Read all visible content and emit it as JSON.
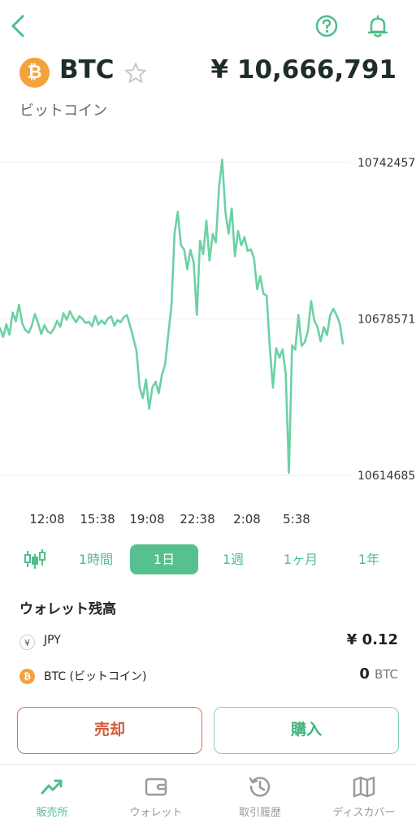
{
  "header": {
    "coin_symbol": "BTC",
    "coin_logo_glyph": "₿",
    "price": "¥ 10,666,791",
    "coin_name": "ビットコイン",
    "icons": [
      "back-chevron-icon",
      "help-icon",
      "bell-icon",
      "star-icon"
    ]
  },
  "chart_data": {
    "type": "line",
    "y_ticks": [
      "10742457",
      "10678571",
      "10614685"
    ],
    "ylim": [
      10614685,
      10742457
    ],
    "x_tick_labels": [
      "12:08",
      "15:38",
      "19:08",
      "22:38",
      "2:08",
      "5:38"
    ],
    "series": [
      {
        "values": [
          10674800,
          10671200,
          10676400,
          10672100,
          10681200,
          10677600,
          10684400,
          10676600,
          10674000,
          10672900,
          10675800,
          10680600,
          10676800,
          10672400,
          10676000,
          10673500,
          10672700,
          10674600,
          10677800,
          10675300,
          10680900,
          10678200,
          10681700,
          10679100,
          10677200,
          10679700,
          10678500,
          10676900,
          10677400,
          10675600,
          10679800,
          10676300,
          10677900,
          10676500,
          10678700,
          10679600,
          10675800,
          10678000,
          10677200,
          10679300,
          10680100,
          10675600,
          10670800,
          10665500,
          10650600,
          10646200,
          10653800,
          10641800,
          10650700,
          10652900,
          10648200,
          10655700,
          10660000,
          10672200,
          10683800,
          10713800,
          10722300,
          10708700,
          10706900,
          10698800,
          10706800,
          10701500,
          10680200,
          10710600,
          10705000,
          10718700,
          10702400,
          10713300,
          10709800,
          10732500,
          10743600,
          10722400,
          10713400,
          10723700,
          10704200,
          10714500,
          10708600,
          10712000,
          10706300,
          10707000,
          10703400,
          10690700,
          10696000,
          10688800,
          10688100,
          10666600,
          10650500,
          10666600,
          10662700,
          10666100,
          10655900,
          10615700,
          10667800,
          10666000,
          10680200,
          10667600,
          10669000,
          10673700,
          10685900,
          10678000,
          10675300,
          10669400,
          10675200,
          10672000,
          10680100,
          10682700,
          10680200,
          10676800,
          10668500
        ]
      }
    ],
    "grid": true,
    "y_axis_position": "right"
  },
  "periods": {
    "candle_icon": "candlestick-icon",
    "items": [
      "1時間",
      "1日",
      "1週",
      "1ヶ月",
      "1年"
    ],
    "active_index": 1
  },
  "wallet": {
    "title": "ウォレット残高",
    "rows": [
      {
        "icon_glyph": "¥",
        "label": "JPY",
        "value": "¥ 0.12",
        "unit": ""
      },
      {
        "icon_glyph": "₿",
        "label": "BTC (ビットコイン)",
        "value": "0",
        "unit": "BTC"
      }
    ]
  },
  "actions": {
    "sell_label": "売却",
    "buy_label": "購入",
    "sell_color": "#d25a36",
    "buy_color": "#3fb47e"
  },
  "nav": {
    "items": [
      {
        "label": "販売所",
        "icon": "trend-up-icon",
        "active": true
      },
      {
        "label": "ウォレット",
        "icon": "wallet-icon",
        "active": false
      },
      {
        "label": "取引履歴",
        "icon": "history-icon",
        "active": false
      },
      {
        "label": "ディスカバー",
        "icon": "map-icon",
        "active": false
      }
    ]
  },
  "colors": {
    "accent": "#56c08f",
    "line": "#6cd1a4",
    "btc": "#F2A33A"
  }
}
